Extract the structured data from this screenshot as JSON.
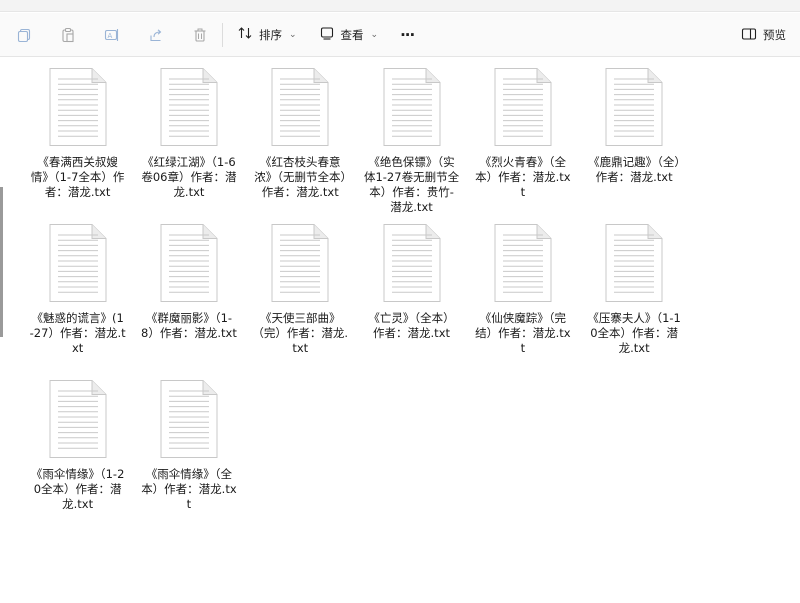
{
  "toolbar": {
    "sort_label": "排序",
    "view_label": "查看",
    "more_label": "···",
    "preview_label": "预览"
  },
  "icons": {
    "copy": "copy-icon",
    "paste": "paste-icon",
    "rename": "rename-icon",
    "share": "share-icon",
    "delete": "delete-icon",
    "sort": "sort-icon",
    "view": "view-icon",
    "preview": "preview-pane-icon",
    "file": "text-file-icon"
  },
  "files": [
    "《春满西关叔嫂情》（1-7全本）作者：潜龙.txt",
    "《红绿江湖》（1-6卷06章）作者：潜龙.txt",
    "《红杏枝头春意浓》（无删节全本）作者：潜龙.txt",
    "《绝色保镖》（实体1-27卷无删节全本）作者：贵竹-潜龙.txt",
    "《烈火青春》（全本）作者：潜龙.txt",
    "《鹿鼎记趣》（全）作者：潜龙.txt",
    "《魅惑的谎言》(1-27）作者：潜龙.txt",
    "《群魔丽影》（1-8）作者：潜龙.txt",
    "《天使三部曲》（完）作者：潜龙.txt",
    "《亡灵》（全本）作者：潜龙.txt",
    "《仙侠魔踪》（完结）作者：潜龙.txt",
    "《压寨夫人》（1-10全本）作者：潜龙.txt",
    "《雨伞情缘》（1-20全本）作者：潜龙.txt",
    "《雨伞情缘》（全本）作者：潜龙.txt"
  ]
}
